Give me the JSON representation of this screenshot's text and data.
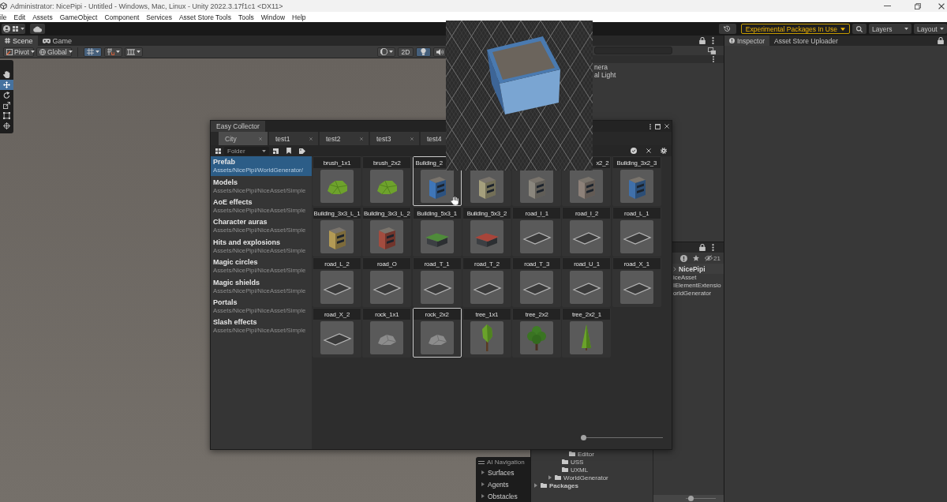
{
  "window": {
    "title": "Administrator: NicePipi - Untitled - Windows, Mac, Linux - Unity 2022.3.17f1c1 <DX11>"
  },
  "menu": [
    "ile",
    "Edit",
    "Assets",
    "GameObject",
    "Component",
    "Services",
    "Asset Store Tools",
    "Tools",
    "Window",
    "Help"
  ],
  "toolbar": {
    "notice": "Experimental Packages In Use",
    "layers": "Layers",
    "layout": "Layout"
  },
  "scene": {
    "tabs": [
      {
        "label": "Scene",
        "kind": "scene",
        "selected": true
      },
      {
        "label": "Game",
        "kind": "game",
        "selected": false
      }
    ],
    "pivot": "Pivot",
    "space": "Global",
    "grid_snap_on": true,
    "mode_2d": {
      "label": "2D",
      "on": false
    },
    "lighting_on": true,
    "tools": [
      {
        "kind": "hand",
        "selected": false
      },
      {
        "kind": "move",
        "selected": true
      },
      {
        "kind": "rotate",
        "selected": false
      },
      {
        "kind": "scale",
        "selected": false
      },
      {
        "kind": "rect",
        "selected": false
      },
      {
        "kind": "transform",
        "selected": false
      }
    ],
    "ai_navigation": {
      "title": "AI Navigation",
      "items": [
        {
          "label": "Surfaces",
          "expanded": false
        },
        {
          "label": "Agents",
          "expanded": false
        },
        {
          "label": "Obstacles",
          "expanded": false
        }
      ]
    }
  },
  "hierarchy": {
    "items": [
      "nera",
      "al Light"
    ]
  },
  "project": {
    "hidden_count": "21",
    "breadcrumb": "NicePipi",
    "items": [
      "iceAsset",
      "IElementExtensio",
      "orldGenerator"
    ],
    "tree": [
      {
        "children": [
          {
            "children": [
              {
                "children": [
                  {
                    "children": [
                      {
                        "label": "Editor"
                      }
                    ]
                  },
                  {
                    "label": "USS"
                  },
                  {
                    "label": "UXML"
                  }
                ]
              },
              {
                "label": "WorldGenerator",
                "expanded": false
              }
            ]
          }
        ]
      },
      {
        "label": "Packages",
        "expanded": false
      }
    ],
    "zoom": {
      "level": 0.1
    }
  },
  "inspector": {
    "tabs": [
      {
        "label": "Inspector",
        "kind": "inspector",
        "selected": true
      },
      {
        "label": "Asset Store Uploader",
        "kind": "uploader",
        "selected": false
      }
    ]
  },
  "easy_collector": {
    "title": "Easy Collector",
    "tabs": [
      {
        "label": "City",
        "selected": true,
        "cut": false
      },
      {
        "label": "test1",
        "selected": false,
        "cut": false
      },
      {
        "label": "test2",
        "selected": false,
        "cut": false
      },
      {
        "label": "test3",
        "selected": false,
        "cut": false
      },
      {
        "label": "test4",
        "selected": false,
        "cut": true
      }
    ],
    "view": "Folder",
    "collections": [
      {
        "name": "Prefab",
        "path": "Assets/NicePipi/WorldGenerator/",
        "selected": true
      },
      {
        "name": "Models",
        "path": "Assets/NicePipi/NiceAsset/Simple",
        "selected": false
      },
      {
        "name": "AoE effects",
        "path": "Assets/NicePipi/NiceAsset/Simple",
        "selected": false
      },
      {
        "name": "Character auras",
        "path": "Assets/NicePipi/NiceAsset/Simple",
        "selected": false
      },
      {
        "name": "Hits and explosions",
        "path": "Assets/NicePipi/NiceAsset/Simple",
        "selected": false
      },
      {
        "name": "Magic circles",
        "path": "Assets/NicePipi/NiceAsset/Simple",
        "selected": false
      },
      {
        "name": "Magic shields",
        "path": "Assets/NicePipi/NiceAsset/Simple",
        "selected": false
      },
      {
        "name": "Portals",
        "path": "Assets/NicePipi/NiceAsset/Simple",
        "selected": false
      },
      {
        "name": "Slash effects",
        "path": "Assets/NicePipi/NiceAsset/Simple",
        "selected": false
      }
    ],
    "assets": [
      {
        "label": "brush_1x1",
        "kind": "bush",
        "selected": false
      },
      {
        "label": "brush_2x2",
        "kind": "bush",
        "selected": false
      },
      {
        "label": "Building_2",
        "cut_right": true,
        "kind": "building",
        "color": "#3f76b8",
        "selected": true
      },
      {
        "kind": "building",
        "color": "#a59f7d",
        "selected": false
      },
      {
        "kind": "building",
        "color": "#8a867d",
        "selected": false
      },
      {
        "label": "x2_2",
        "cut_left": true,
        "kind": "building",
        "color": "#8d8179",
        "selected": false
      },
      {
        "label": "Building_3x2_3",
        "kind": "building",
        "color": "#4070aa",
        "selected": false
      },
      {
        "label": "Building_3x3_L_1",
        "kind": "building",
        "color": "#b39a55",
        "selected": false
      },
      {
        "label": "Building_3x3_L_2",
        "kind": "building",
        "color": "#a24c3f",
        "selected": false
      },
      {
        "label": "Building_5x3_1",
        "kind": "house",
        "color": "#4f8b3a",
        "selected": false
      },
      {
        "label": "Building_5x3_2",
        "kind": "house",
        "color": "#a8453a",
        "selected": false
      },
      {
        "label": "road_I_1",
        "kind": "road",
        "selected": false
      },
      {
        "label": "road_I_2",
        "kind": "road",
        "selected": false
      },
      {
        "label": "road_L_1",
        "kind": "road",
        "selected": false
      },
      {
        "label": "road_L_2",
        "kind": "road",
        "selected": false
      },
      {
        "label": "road_O",
        "kind": "road",
        "selected": false
      },
      {
        "label": "road_T_1",
        "kind": "road",
        "selected": false
      },
      {
        "label": "road_T_2",
        "kind": "road",
        "selected": false
      },
      {
        "label": "road_T_3",
        "kind": "road",
        "selected": false
      },
      {
        "label": "road_U_1",
        "kind": "road",
        "selected": false
      },
      {
        "label": "road_X_1",
        "kind": "road",
        "selected": false
      },
      {
        "label": "road_X_2",
        "kind": "road",
        "selected": false
      },
      {
        "label": "rock_1x1",
        "kind": "rock",
        "selected": false
      },
      {
        "label": "rock_2x2",
        "kind": "rock",
        "selected": true
      },
      {
        "label": "tree_1x1",
        "kind": "tree",
        "selected": false
      },
      {
        "label": "tree_2x2",
        "kind": "oak",
        "selected": false
      },
      {
        "label": "tree_2x2_1",
        "kind": "pine",
        "selected": false
      }
    ],
    "zoom": {
      "level": 0
    }
  }
}
